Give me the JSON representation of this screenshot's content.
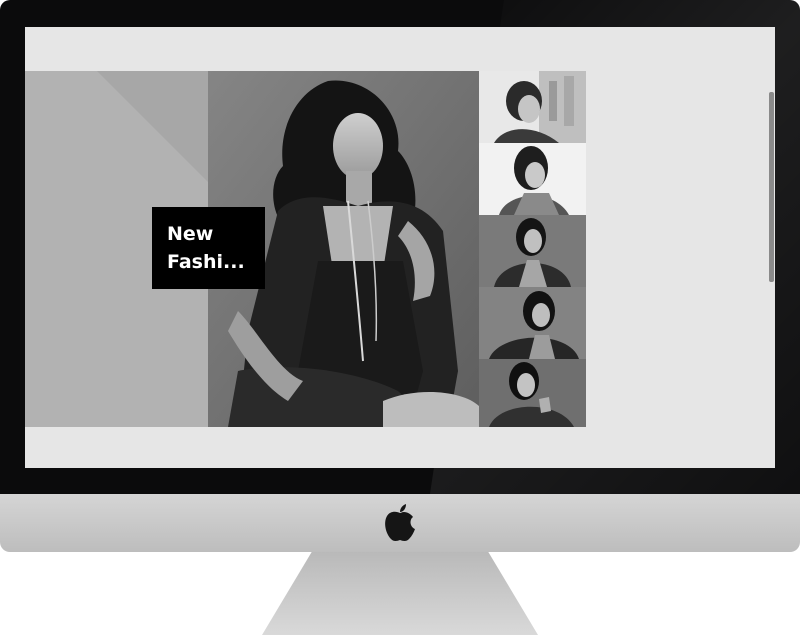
{
  "slide": {
    "title": "New\nFashi..."
  },
  "gallery": {
    "thumbnail_count": 5,
    "active_index": 0
  },
  "colors": {
    "screen_bg": "#e6e6e6",
    "panel_gray": "#a7a7a7",
    "title_bg": "#000000",
    "title_fg": "#ffffff"
  }
}
